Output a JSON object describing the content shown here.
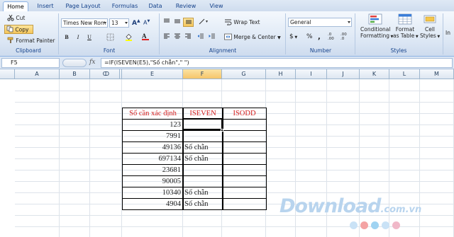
{
  "tabs": [
    "Home",
    "Insert",
    "Page Layout",
    "Formulas",
    "Data",
    "Review",
    "View"
  ],
  "clipboard": {
    "cut": "Cut",
    "copy": "Copy",
    "format_painter": "Format Painter",
    "label": "Clipboard"
  },
  "font": {
    "name": "Times New Rom",
    "size": "13",
    "label": "Font",
    "bold": "B",
    "italic": "I",
    "underline": "U",
    "font_color": "A"
  },
  "alignment": {
    "wrap_text": "Wrap Text",
    "merge_center": "Merge & Center",
    "label": "Alignment"
  },
  "number": {
    "format": "General",
    "currency": "$",
    "percent": "%",
    "comma": ",",
    "inc_dec": ".0 .00",
    "dec_dec": ".00 .0",
    "label": "Number"
  },
  "styles": {
    "conditional": [
      "Conditional",
      "Formatting"
    ],
    "table": [
      "Format",
      "as Table"
    ],
    "cell": [
      "Cell",
      "Styles"
    ],
    "label": "Styles",
    "insert": "In"
  },
  "formula_bar": {
    "name_box": "F5",
    "fx": "fx",
    "formula": "=IF(ISEVEN(E5),\"Số chẵn\",\" \")"
  },
  "columns": [
    "A",
    "B",
    "C",
    "D",
    "E",
    "F",
    "G",
    "H",
    "I",
    "J",
    "K",
    "L",
    "M"
  ],
  "selected_column": "F",
  "table": {
    "headers": [
      "Số cần xác định",
      "ISEVEN",
      "ISODD"
    ],
    "rows": [
      {
        "value": "123",
        "iseven": "",
        "isodd": ""
      },
      {
        "value": "7991",
        "iseven": "",
        "isodd": ""
      },
      {
        "value": "49136",
        "iseven": "Số chẵn",
        "isodd": ""
      },
      {
        "value": "697134",
        "iseven": "Số chẵn",
        "isodd": ""
      },
      {
        "value": "23681",
        "iseven": "",
        "isodd": ""
      },
      {
        "value": "90005",
        "iseven": "",
        "isodd": ""
      },
      {
        "value": "10340",
        "iseven": "Số chẵn",
        "isodd": ""
      },
      {
        "value": "4904",
        "iseven": "Số chẵn",
        "isodd": ""
      }
    ]
  },
  "watermark": {
    "brand": "Download",
    "tld": ".com.vn"
  },
  "colors": {
    "header_red": "#d21c1c",
    "accent_blue": "#15428b",
    "selected_col": "#f6c56a"
  }
}
